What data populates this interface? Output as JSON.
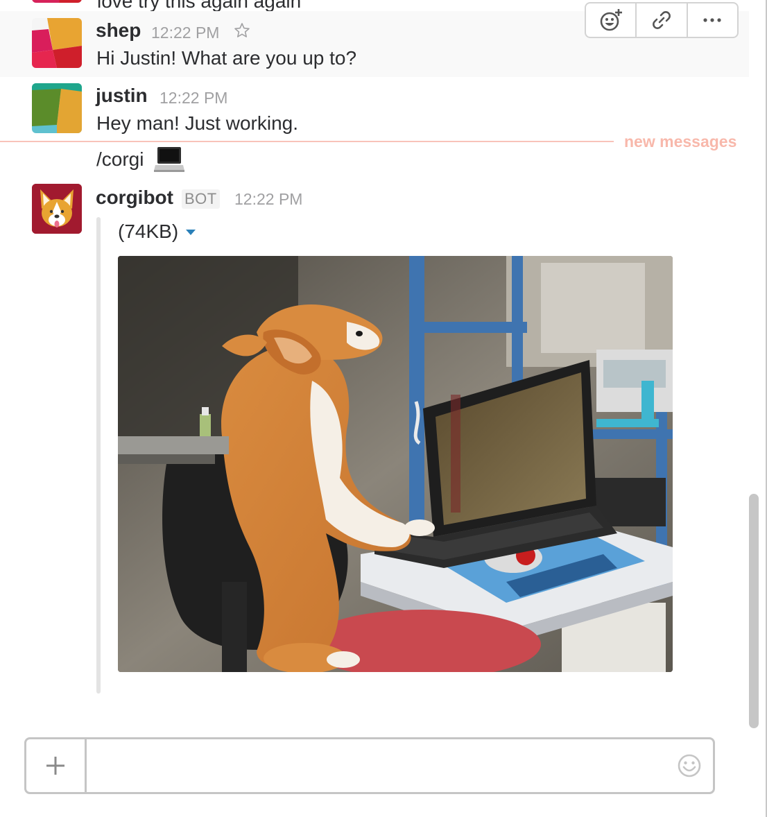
{
  "previous_message": {
    "text": "love try this again again"
  },
  "messages": [
    {
      "sender": "shep",
      "time": "12:22 PM",
      "text": "Hi Justin!  What are you up to?"
    },
    {
      "sender": "justin",
      "time": "12:22 PM",
      "text": "Hey man!  Just working."
    }
  ],
  "divider": {
    "label": "new messages"
  },
  "command": {
    "text": "/corgi"
  },
  "bot_message": {
    "sender": "corgibot",
    "badge": "BOT",
    "time": "12:22 PM",
    "file_size": "(74KB)"
  },
  "hover_actions": {
    "icons": [
      "add-reaction-icon",
      "link-icon",
      "more-icon"
    ]
  },
  "composer": {
    "value": "",
    "placeholder": ""
  },
  "colors": {
    "text": "#2c2d30",
    "muted": "#a0a0a2",
    "divider": "#f8c3b9",
    "link_caret": "#2a80b9"
  }
}
